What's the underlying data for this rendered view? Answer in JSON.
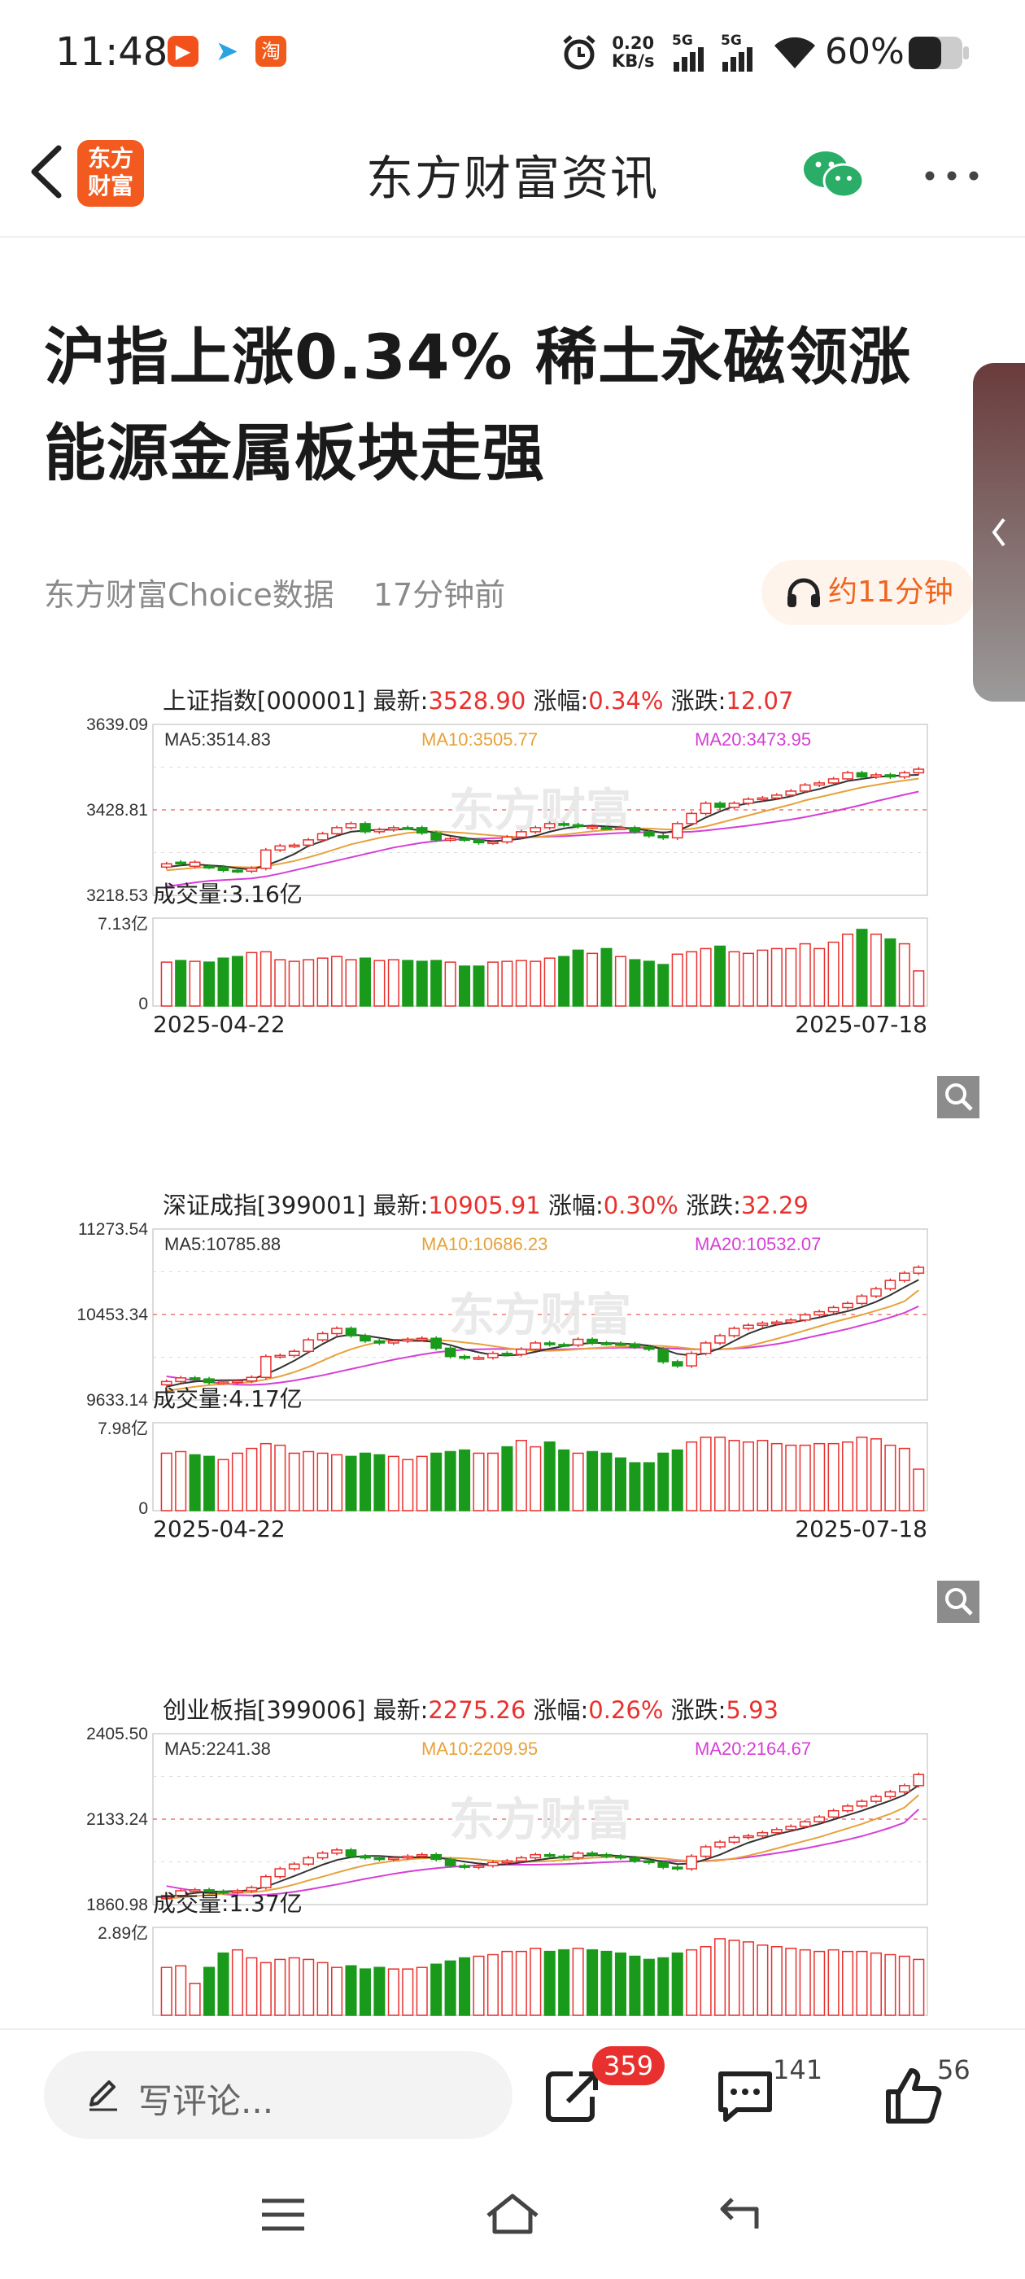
{
  "status_bar": {
    "time": "11:48",
    "net_speed_top": "0.20",
    "net_speed_bottom": "KB/s",
    "sig1": "5G",
    "sig2": "5G",
    "battery": "60%",
    "icons": [
      "app-icon-orange",
      "telegram-icon",
      "taobao-icon",
      "alarm-icon",
      "signal-icon",
      "wifi-icon",
      "battery-icon"
    ]
  },
  "header": {
    "logo_line1": "东方",
    "logo_line2": "财富",
    "title": "东方财富资讯",
    "icons": [
      "back-arrow-icon",
      "wechat-icon",
      "more-dots-icon"
    ]
  },
  "article": {
    "headline": "沪指上涨0.34% 稀土永磁领涨 能源金属板块走强",
    "source": "东方财富Choice数据",
    "time_ago": "17分钟前",
    "audio_label": "约11分钟",
    "audio_icon": "headphones-icon"
  },
  "watermark": "东方财富",
  "chart_data": [
    {
      "type": "candlestick",
      "name": "上证指数[000001]",
      "latest_label": "最新:",
      "latest": "3528.90",
      "change_pct_label": "涨幅:",
      "change_pct": "0.34%",
      "change_label": "涨跌:",
      "change": "12.07",
      "ma5": "MA5:3514.83",
      "ma10": "MA10:3505.77",
      "ma20": "MA20:3473.95",
      "yticks": [
        "3639.09",
        "3428.81",
        "3218.53"
      ],
      "ylim": [
        3218.53,
        3639.09
      ],
      "volume_label": "成交量:3.16亿",
      "vol_ticks": [
        "7.13亿",
        "0"
      ],
      "x_start": "2025-04-22",
      "x_end": "2025-07-18",
      "close": [
        3296,
        3300,
        3290,
        3288,
        3280,
        3278,
        3285,
        3330,
        3340,
        3342,
        3355,
        3370,
        3385,
        3395,
        3375,
        3380,
        3385,
        3385,
        3372,
        3355,
        3358,
        3355,
        3348,
        3350,
        3362,
        3375,
        3385,
        3395,
        3392,
        3388,
        3385,
        3385,
        3385,
        3375,
        3365,
        3360,
        3395,
        3420,
        3445,
        3435,
        3445,
        3455,
        3458,
        3465,
        3475,
        3490,
        3495,
        3505,
        3520,
        3510,
        3515,
        3510,
        3520,
        3528.9
      ],
      "up": [
        1,
        0,
        1,
        0,
        0,
        0,
        1,
        1,
        1,
        1,
        1,
        1,
        1,
        1,
        0,
        1,
        1,
        0,
        0,
        0,
        1,
        0,
        0,
        1,
        1,
        1,
        1,
        1,
        0,
        0,
        1,
        0,
        1,
        0,
        0,
        0,
        1,
        1,
        1,
        0,
        1,
        1,
        1,
        1,
        1,
        1,
        1,
        1,
        1,
        0,
        1,
        0,
        1,
        1
      ],
      "ma5_line": [
        3288,
        3292,
        3295,
        3292,
        3290,
        3285,
        3282,
        3292,
        3305,
        3320,
        3340,
        3352,
        3365,
        3375,
        3378,
        3380,
        3380,
        3382,
        3378,
        3372,
        3365,
        3360,
        3355,
        3352,
        3354,
        3358,
        3365,
        3375,
        3383,
        3388,
        3390,
        3388,
        3386,
        3382,
        3378,
        3372,
        3378,
        3392,
        3410,
        3425,
        3438,
        3445,
        3450,
        3455,
        3462,
        3472,
        3480,
        3490,
        3500,
        3505,
        3510,
        3512,
        3514,
        3514.83
      ],
      "ma10_line": [
        3280,
        3283,
        3286,
        3288,
        3289,
        3288,
        3287,
        3290,
        3296,
        3303,
        3312,
        3322,
        3333,
        3344,
        3352,
        3360,
        3366,
        3372,
        3375,
        3376,
        3374,
        3372,
        3369,
        3366,
        3363,
        3362,
        3362,
        3365,
        3368,
        3372,
        3376,
        3379,
        3381,
        3383,
        3383,
        3381,
        3380,
        3382,
        3388,
        3397,
        3406,
        3415,
        3424,
        3433,
        3442,
        3452,
        3460,
        3468,
        3476,
        3484,
        3490,
        3496,
        3501,
        3505.77
      ],
      "ma20_line": [
        3240,
        3245,
        3250,
        3254,
        3256,
        3258,
        3260,
        3265,
        3272,
        3280,
        3288,
        3296,
        3304,
        3312,
        3320,
        3328,
        3336,
        3342,
        3348,
        3352,
        3355,
        3357,
        3358,
        3359,
        3360,
        3361,
        3362,
        3363,
        3364,
        3366,
        3368,
        3370,
        3372,
        3373,
        3374,
        3374,
        3374,
        3375,
        3378,
        3382,
        3386,
        3390,
        3395,
        3400,
        3405,
        3411,
        3418,
        3425,
        3433,
        3441,
        3450,
        3458,
        3466,
        3473.95
      ],
      "volume": [
        0.55,
        0.57,
        0.56,
        0.55,
        0.6,
        0.62,
        0.67,
        0.68,
        0.58,
        0.56,
        0.58,
        0.6,
        0.62,
        0.58,
        0.6,
        0.57,
        0.58,
        0.57,
        0.56,
        0.57,
        0.55,
        0.5,
        0.5,
        0.55,
        0.56,
        0.57,
        0.56,
        0.6,
        0.62,
        0.7,
        0.66,
        0.72,
        0.62,
        0.58,
        0.56,
        0.52,
        0.65,
        0.68,
        0.72,
        0.75,
        0.68,
        0.66,
        0.7,
        0.72,
        0.72,
        0.78,
        0.72,
        0.8,
        0.9,
        0.96,
        0.9,
        0.84,
        0.78,
        0.44
      ]
    },
    {
      "type": "candlestick",
      "name": "深证成指[399001]",
      "latest_label": "最新:",
      "latest": "10905.91",
      "change_pct_label": "涨幅:",
      "change_pct": "0.30%",
      "change_label": "涨跌:",
      "change": "32.29",
      "ma5": "MA5:10785.88",
      "ma10": "MA10:10686.23",
      "ma20": "MA20:10532.07",
      "yticks": [
        "11273.54",
        "10453.34",
        "9633.14"
      ],
      "ylim": [
        9633.14,
        11273.54
      ],
      "volume_label": "成交量:4.17亿",
      "vol_ticks": [
        "7.98亿",
        "0"
      ],
      "x_start": "2025-04-22",
      "x_end": "2025-07-18",
      "close": [
        9810,
        9845,
        9835,
        9800,
        9805,
        9815,
        9850,
        10050,
        10060,
        10100,
        10210,
        10270,
        10320,
        10250,
        10200,
        10180,
        10200,
        10215,
        10225,
        10130,
        10050,
        10035,
        10040,
        10080,
        10070,
        10120,
        10180,
        10165,
        10160,
        10215,
        10180,
        10175,
        10170,
        10140,
        10120,
        10000,
        9960,
        10080,
        10180,
        10250,
        10320,
        10350,
        10370,
        10380,
        10400,
        10450,
        10480,
        10520,
        10560,
        10630,
        10700,
        10780,
        10850,
        10905.91
      ],
      "up": [
        1,
        1,
        0,
        0,
        1,
        1,
        1,
        1,
        1,
        1,
        1,
        1,
        1,
        0,
        0,
        0,
        1,
        1,
        1,
        0,
        0,
        0,
        1,
        1,
        0,
        1,
        1,
        0,
        0,
        1,
        0,
        0,
        0,
        0,
        0,
        0,
        0,
        1,
        1,
        1,
        1,
        1,
        1,
        1,
        1,
        1,
        1,
        1,
        1,
        1,
        1,
        1,
        1,
        1
      ],
      "ma5_line": [
        9760,
        9790,
        9810,
        9820,
        9822,
        9822,
        9830,
        9880,
        9940,
        10010,
        10090,
        10170,
        10240,
        10260,
        10250,
        10230,
        10210,
        10200,
        10200,
        10190,
        10160,
        10120,
        10090,
        10065,
        10060,
        10068,
        10095,
        10125,
        10150,
        10170,
        10180,
        10180,
        10175,
        10168,
        10155,
        10120,
        10075,
        10060,
        10080,
        10130,
        10200,
        10270,
        10320,
        10355,
        10375,
        10400,
        10425,
        10455,
        10485,
        10525,
        10575,
        10640,
        10715,
        10785.88
      ],
      "ma10_line": [
        9720,
        9740,
        9760,
        9775,
        9785,
        9795,
        9805,
        9830,
        9860,
        9900,
        9950,
        10010,
        10070,
        10120,
        10160,
        10190,
        10210,
        10215,
        10215,
        10210,
        10200,
        10185,
        10170,
        10150,
        10130,
        10115,
        10105,
        10105,
        10110,
        10120,
        10130,
        10138,
        10145,
        10150,
        10155,
        10150,
        10140,
        10125,
        10115,
        10120,
        10130,
        10150,
        10185,
        10220,
        10260,
        10300,
        10340,
        10380,
        10415,
        10450,
        10490,
        10530,
        10580,
        10686.23
      ],
      "ma20_line": [
        9860,
        9840,
        9820,
        9805,
        9790,
        9780,
        9778,
        9785,
        9800,
        9820,
        9845,
        9870,
        9900,
        9930,
        9960,
        9990,
        10020,
        10045,
        10070,
        10090,
        10105,
        10115,
        10120,
        10122,
        10122,
        10120,
        10118,
        10118,
        10120,
        10124,
        10128,
        10132,
        10135,
        10136,
        10135,
        10130,
        10125,
        10120,
        10118,
        10120,
        10125,
        10135,
        10150,
        10170,
        10195,
        10225,
        10255,
        10285,
        10315,
        10350,
        10385,
        10425,
        10470,
        10532.07
      ],
      "volume": [
        0.72,
        0.74,
        0.7,
        0.68,
        0.64,
        0.72,
        0.78,
        0.84,
        0.82,
        0.72,
        0.74,
        0.72,
        0.7,
        0.68,
        0.72,
        0.7,
        0.68,
        0.64,
        0.68,
        0.72,
        0.74,
        0.76,
        0.72,
        0.72,
        0.8,
        0.88,
        0.8,
        0.86,
        0.76,
        0.72,
        0.74,
        0.72,
        0.66,
        0.6,
        0.6,
        0.72,
        0.76,
        0.86,
        0.92,
        0.92,
        0.88,
        0.86,
        0.88,
        0.84,
        0.82,
        0.82,
        0.84,
        0.84,
        0.86,
        0.92,
        0.9,
        0.82,
        0.78,
        0.52
      ]
    },
    {
      "type": "candlestick",
      "name": "创业板指[399006]",
      "latest_label": "最新:",
      "latest": "2275.26",
      "change_pct_label": "涨幅:",
      "change_pct": "0.26%",
      "change_label": "涨跌:",
      "change": "5.93",
      "ma5": "MA5:2241.38",
      "ma10": "MA10:2209.95",
      "ma20": "MA20:2164.67",
      "yticks": [
        "2405.50",
        "2133.24",
        "1860.98"
      ],
      "ylim": [
        1860.98,
        2405.5
      ],
      "volume_label": "成交量:1.37亿",
      "vol_ticks": [
        "2.89亿"
      ],
      "x_start": "",
      "x_end": "",
      "close": [
        1890,
        1905,
        1908,
        1903,
        1900,
        1905,
        1915,
        1950,
        1975,
        1990,
        2010,
        2025,
        2035,
        2015,
        2010,
        2005,
        2010,
        2015,
        2020,
        2005,
        1985,
        1980,
        1985,
        1995,
        2000,
        2010,
        2020,
        2015,
        2010,
        2025,
        2020,
        2015,
        2010,
        2000,
        1995,
        1980,
        1975,
        2015,
        2045,
        2060,
        2075,
        2080,
        2090,
        2100,
        2110,
        2125,
        2140,
        2160,
        2175,
        2190,
        2205,
        2220,
        2240,
        2275.26
      ],
      "up": [
        1,
        1,
        1,
        0,
        0,
        1,
        1,
        1,
        1,
        1,
        1,
        1,
        1,
        0,
        0,
        0,
        1,
        1,
        1,
        0,
        0,
        0,
        1,
        1,
        1,
        1,
        1,
        0,
        0,
        1,
        0,
        0,
        0,
        0,
        0,
        0,
        0,
        1,
        1,
        1,
        1,
        1,
        1,
        1,
        1,
        1,
        1,
        1,
        1,
        1,
        1,
        1,
        1,
        1
      ],
      "ma5_line": [
        1885,
        1892,
        1898,
        1902,
        1903,
        1904,
        1907,
        1918,
        1935,
        1952,
        1970,
        1988,
        2003,
        2012,
        2016,
        2016,
        2013,
        2011,
        2012,
        2011,
        2005,
        1998,
        1992,
        1988,
        1990,
        1995,
        2002,
        2008,
        2012,
        2016,
        2018,
        2018,
        2016,
        2012,
        2006,
        1998,
        1990,
        1992,
        2005,
        2020,
        2040,
        2058,
        2072,
        2085,
        2095,
        2106,
        2118,
        2132,
        2146,
        2160,
        2176,
        2192,
        2210,
        2241.38
      ],
      "ma10_line": [
        1880,
        1884,
        1888,
        1892,
        1895,
        1898,
        1900,
        1905,
        1914,
        1925,
        1938,
        1950,
        1963,
        1975,
        1986,
        1994,
        2000,
        2005,
        2008,
        2010,
        2010,
        2008,
        2005,
        2001,
        1999,
        1998,
        1998,
        2000,
        2003,
        2007,
        2010,
        2012,
        2013,
        2013,
        2011,
        2008,
        2003,
        2000,
        1999,
        2002,
        2008,
        2017,
        2028,
        2040,
        2052,
        2064,
        2076,
        2090,
        2104,
        2118,
        2134,
        2150,
        2170,
        2209.95
      ],
      "ma20_line": [
        1920,
        1912,
        1905,
        1898,
        1894,
        1891,
        1890,
        1892,
        1896,
        1902,
        1909,
        1917,
        1925,
        1934,
        1943,
        1951,
        1959,
        1966,
        1972,
        1977,
        1981,
        1984,
        1986,
        1987,
        1988,
        1988,
        1988,
        1989,
        1990,
        1992,
        1994,
        1996,
        1998,
        1999,
        2000,
        2000,
        1999,
        1999,
        2000,
        2003,
        2007,
        2012,
        2018,
        2025,
        2032,
        2040,
        2049,
        2058,
        2068,
        2079,
        2092,
        2106,
        2122,
        2164.67
      ],
      "volume": [
        0.6,
        0.62,
        0.4,
        0.6,
        0.78,
        0.82,
        0.72,
        0.66,
        0.7,
        0.72,
        0.7,
        0.66,
        0.6,
        0.62,
        0.58,
        0.6,
        0.58,
        0.58,
        0.6,
        0.64,
        0.68,
        0.72,
        0.74,
        0.76,
        0.8,
        0.8,
        0.84,
        0.8,
        0.82,
        0.84,
        0.82,
        0.8,
        0.78,
        0.74,
        0.7,
        0.72,
        0.78,
        0.82,
        0.86,
        0.96,
        0.94,
        0.92,
        0.88,
        0.86,
        0.84,
        0.82,
        0.8,
        0.82,
        0.8,
        0.8,
        0.78,
        0.76,
        0.74,
        0.7
      ]
    }
  ],
  "bottom_bar": {
    "comment_placeholder": "写评论...",
    "share_count": "359",
    "comment_count": "141",
    "like_count": "56",
    "icons": [
      "pencil-icon",
      "share-icon",
      "comment-icon",
      "like-icon"
    ]
  },
  "nav_bar": {
    "icons": [
      "menu-icon",
      "home-icon",
      "back-icon"
    ]
  }
}
